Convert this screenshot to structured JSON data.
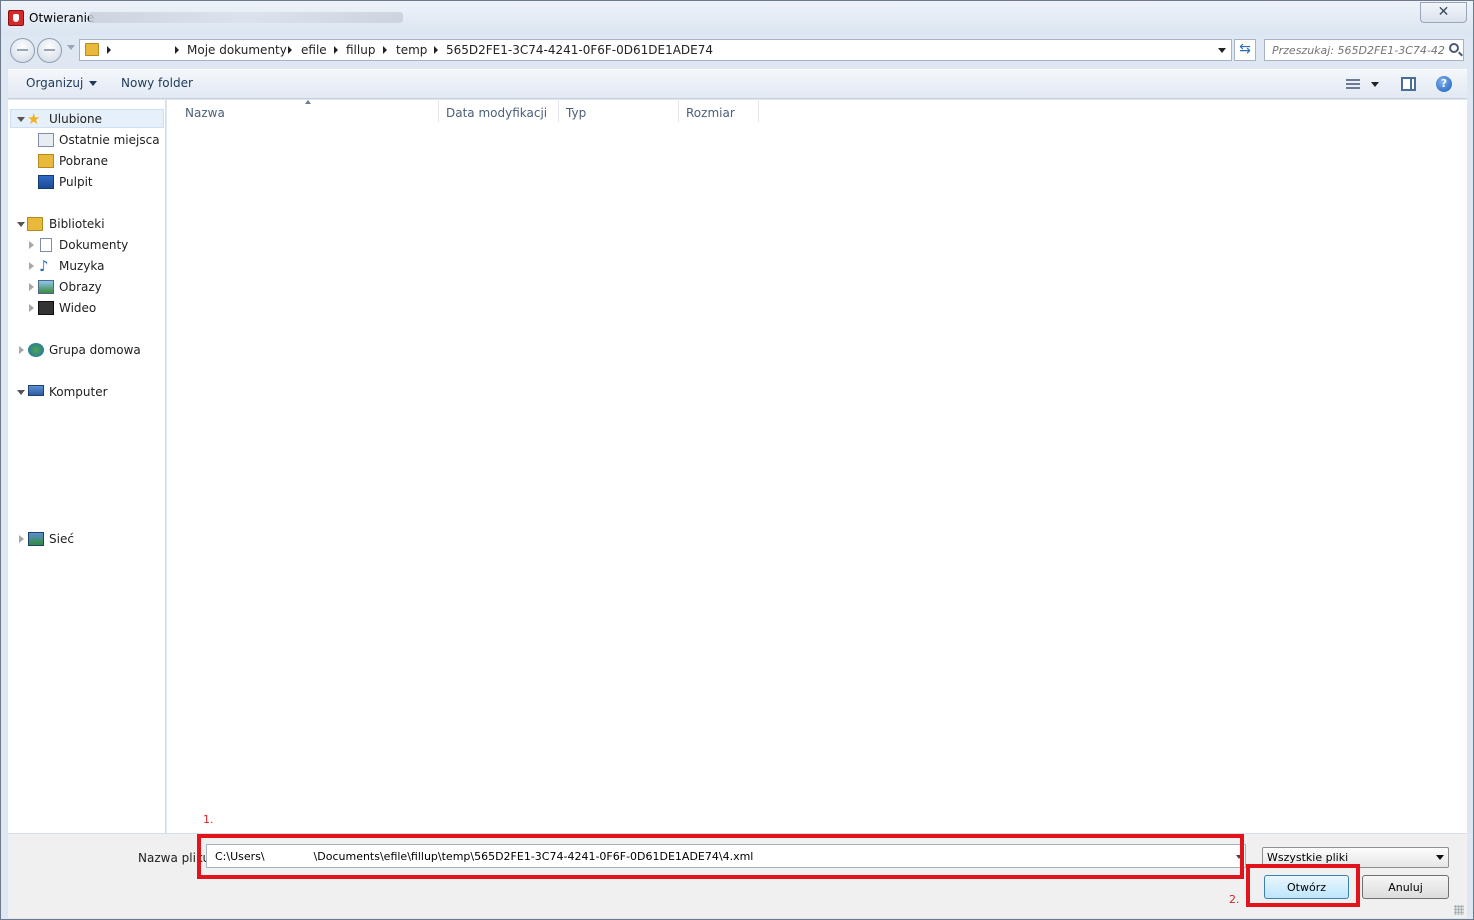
{
  "window": {
    "title": "Otwieranie",
    "close_glyph": "✕"
  },
  "address_bar": {
    "crumbs": [
      "Moje dokumenty",
      "efile",
      "fillup",
      "temp",
      "565D2FE1-3C74-4241-0F6F-0D61DE1ADE74"
    ],
    "search_placeholder": "Przeszukaj: 565D2FE1-3C74-42..."
  },
  "toolbar": {
    "organize_label": "Organizuj",
    "new_folder_label": "Nowy folder",
    "help_glyph": "?"
  },
  "nav_pane": {
    "favorites": {
      "label": "Ulubione",
      "items": [
        "Ostatnie miejsca",
        "Pobrane",
        "Pulpit"
      ]
    },
    "libraries": {
      "label": "Biblioteki",
      "items": [
        "Dokumenty",
        "Muzyka",
        "Obrazy",
        "Wideo"
      ]
    },
    "homegroup": {
      "label": "Grupa domowa"
    },
    "computer": {
      "label": "Komputer"
    },
    "network": {
      "label": "Sieć"
    }
  },
  "file_list": {
    "columns": [
      "Nazwa",
      "Data modyfikacji",
      "Typ",
      "Rozmiar"
    ],
    "sort_column": "Nazwa"
  },
  "bottom": {
    "filename_label": "Nazwa pliku:",
    "filename_value": "C:\\Users\\              \\Documents\\efile\\fillup\\temp\\565D2FE1-3C74-4241-0F6F-0D61DE1ADE74\\4.xml",
    "filter_value": "Wszystkie pliki",
    "open_label": "Otwórz",
    "cancel_label": "Anuluj"
  },
  "annotations": {
    "step1": "1.",
    "step2": "2.",
    "color": "#e3131b"
  }
}
